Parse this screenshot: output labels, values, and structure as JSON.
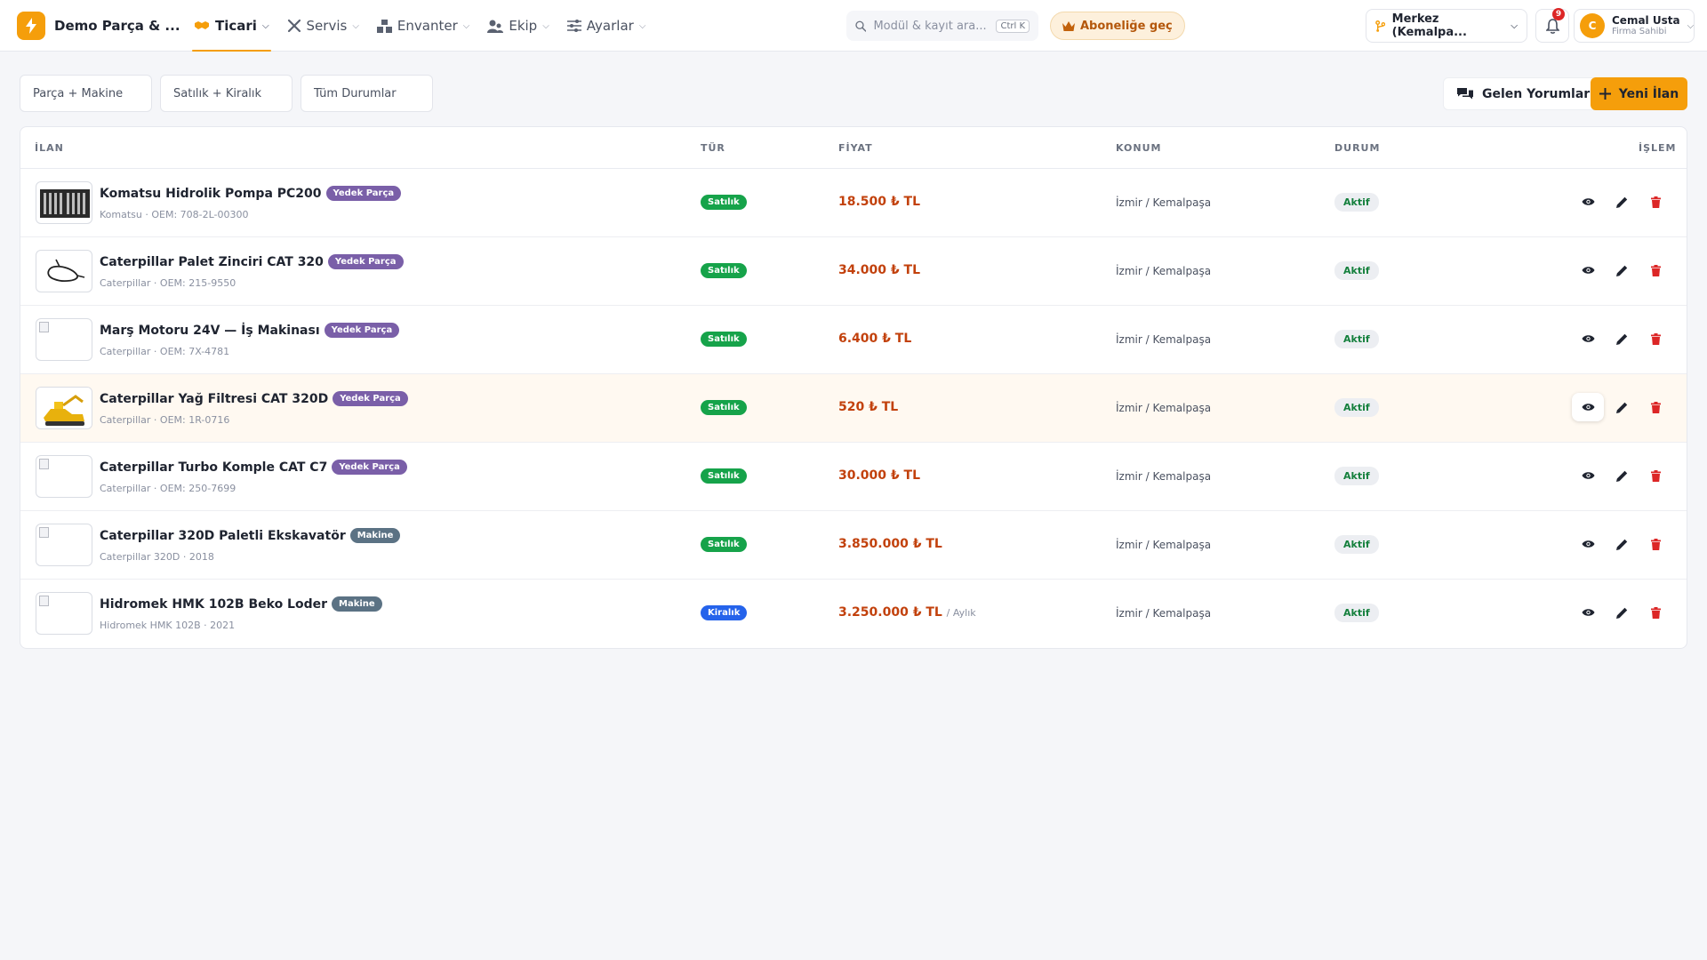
{
  "app": {
    "brand": "Demo Parça & ...",
    "icon": "bolt-icon",
    "accent": "#f59e0b"
  },
  "nav": [
    {
      "label": "Ticari",
      "icon": "handshake-icon",
      "active": true
    },
    {
      "label": "Servis",
      "icon": "tools-icon",
      "active": false
    },
    {
      "label": "Envanter",
      "icon": "boxes-icon",
      "active": false
    },
    {
      "label": "Ekip",
      "icon": "users-icon",
      "active": false
    },
    {
      "label": "Ayarlar",
      "icon": "sliders-icon",
      "active": false
    }
  ],
  "search": {
    "placeholder": "Modül & kayıt ara...",
    "shortcut": "Ctrl K"
  },
  "subscribe": {
    "label": "Aboneliğe geç",
    "icon": "crown-icon"
  },
  "branch": {
    "label": "Merkez (Kemalpa...",
    "icon": "branch-icon"
  },
  "notifications": {
    "count": "9"
  },
  "user": {
    "initial": "C",
    "name": "Cemal Usta",
    "role": "Firma Sahibi"
  },
  "filters": [
    "Parça + Makine",
    "Satılık + Kiralık",
    "Tüm Durumlar"
  ],
  "buttons": {
    "comments": "Gelen Yorumlar",
    "new_listing": "Yeni İlan"
  },
  "table": {
    "headers": {
      "listing": "İLAN",
      "type": "TÜR",
      "price": "FİYAT",
      "location": "KONUM",
      "status": "DURUM",
      "action": "İŞLEM"
    },
    "rows": [
      {
        "title": "Komatsu Hidrolik Pompa PC200",
        "category": "Yedek Parça",
        "sub": "Komatsu · OEM: 708-2L-00300",
        "type": "Satılık",
        "price": "18.500 ₺ TL",
        "period": "",
        "location": "İzmir / Kemalpaşa",
        "status": "Aktif",
        "thumb": "tools-photo"
      },
      {
        "title": "Caterpillar Palet Zinciri CAT 320",
        "category": "Yedek Parça",
        "sub": "Caterpillar · OEM: 215-9550",
        "type": "Satılık",
        "price": "34.000 ₺ TL",
        "period": "",
        "location": "İzmir / Kemalpaşa",
        "status": "Aktif",
        "thumb": "sketch-photo"
      },
      {
        "title": "Marş Motoru 24V — İş Makinası",
        "category": "Yedek Parça",
        "sub": "Caterpillar · OEM: 7X-4781",
        "type": "Satılık",
        "price": "6.400 ₺ TL",
        "period": "",
        "location": "İzmir / Kemalpaşa",
        "status": "Aktif",
        "thumb": "broken-image"
      },
      {
        "title": "Caterpillar Yağ Filtresi CAT 320D",
        "category": "Yedek Parça",
        "sub": "Caterpillar · OEM: 1R-0716",
        "type": "Satılık",
        "price": "520 ₺ TL",
        "period": "",
        "location": "İzmir / Kemalpaşa",
        "status": "Aktif",
        "thumb": "excavator-photo"
      },
      {
        "title": "Caterpillar Turbo Komple CAT C7",
        "category": "Yedek Parça",
        "sub": "Caterpillar · OEM: 250-7699",
        "type": "Satılık",
        "price": "30.000 ₺ TL",
        "period": "",
        "location": "İzmir / Kemalpaşa",
        "status": "Aktif",
        "thumb": "broken-image"
      },
      {
        "title": "Caterpillar 320D Paletli Ekskavatör",
        "category": "Makine",
        "sub": "Caterpillar 320D · 2018",
        "type": "Satılık",
        "price": "3.850.000 ₺ TL",
        "period": "",
        "location": "İzmir / Kemalpaşa",
        "status": "Aktif",
        "thumb": "broken-image"
      },
      {
        "title": "Hidromek HMK 102B Beko Loder",
        "category": "Makine",
        "sub": "Hidromek HMK 102B · 2021",
        "type": "Kiralık",
        "price": "3.250.000 ₺ TL",
        "period": "/ Aylık",
        "location": "İzmir / Kemalpaşa",
        "status": "Aktif",
        "thumb": "broken-image"
      }
    ]
  },
  "colors": {
    "sale": "#16a34a",
    "rent": "#2563eb",
    "price": "#c2410c",
    "part_badge": "#7a5fa8",
    "machine_badge": "#5b7284",
    "delete": "#dc2626"
  }
}
